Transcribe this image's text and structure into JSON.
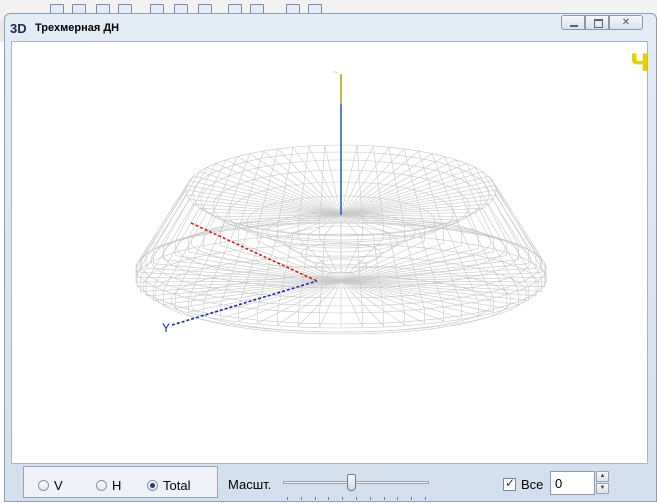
{
  "window": {
    "app_icon": "3D",
    "title": "Трехмерная ДН"
  },
  "viewport": {
    "corner_marker": "Ч",
    "axis_label_y": "Y"
  },
  "controls": {
    "radios": [
      {
        "label": "V",
        "selected": false
      },
      {
        "label": "H",
        "selected": false
      },
      {
        "label": "Total",
        "selected": true
      }
    ],
    "scale_label": "Масшт.",
    "scale_level": 0.47,
    "all_label": "Все",
    "all_checked": true,
    "spin_value": "0"
  },
  "colors": {
    "mesh": "#c8c8c8",
    "axis_z": "#2b63c9",
    "axis_z_top": "#c8c81e",
    "axis_x": "#d21e1e",
    "axis_y": "#1a2aa0",
    "corner_marker": "#e6d000"
  }
}
